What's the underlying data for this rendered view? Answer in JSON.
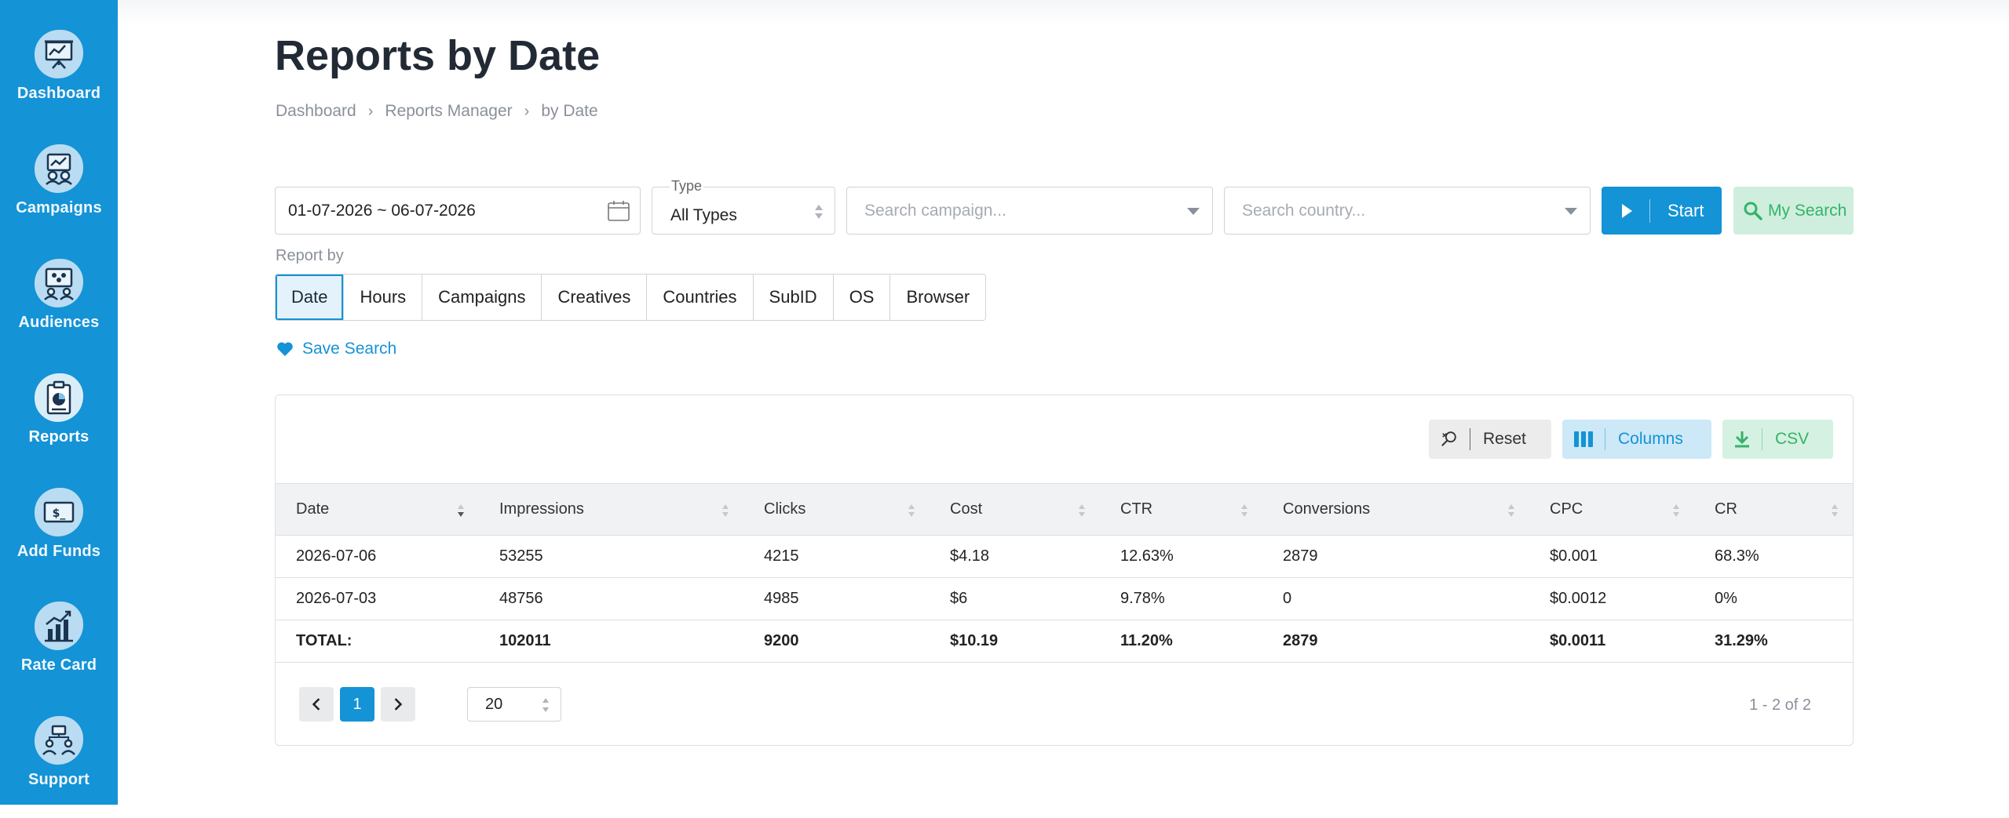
{
  "sidebar": {
    "items": [
      {
        "label": "Dashboard",
        "icon": "dashboard-icon"
      },
      {
        "label": "Campaigns",
        "icon": "campaigns-icon"
      },
      {
        "label": "Audiences",
        "icon": "audiences-icon"
      },
      {
        "label": "Reports",
        "icon": "reports-icon",
        "active": true
      },
      {
        "label": "Add Funds",
        "icon": "add-funds-icon"
      },
      {
        "label": "Rate Card",
        "icon": "rate-card-icon"
      },
      {
        "label": "Support",
        "icon": "support-icon"
      }
    ]
  },
  "page": {
    "title": "Reports by Date",
    "breadcrumb": [
      "Dashboard",
      "Reports Manager",
      "by Date"
    ]
  },
  "filters": {
    "date_range": "01-07-2026 ~ 06-07-2026",
    "type_label": "Type",
    "type_value": "All Types",
    "campaign_placeholder": "Search campaign...",
    "country_placeholder": "Search country...",
    "start_label": "Start",
    "my_search_label": "My Search",
    "report_by_label": "Report by",
    "report_by_options": [
      "Date",
      "Hours",
      "Campaigns",
      "Creatives",
      "Countries",
      "SubID",
      "OS",
      "Browser"
    ],
    "report_by_selected": "Date",
    "save_search_label": "Save Search"
  },
  "toolbar": {
    "reset_label": "Reset",
    "columns_label": "Columns",
    "csv_label": "CSV"
  },
  "table": {
    "columns": [
      "Date",
      "Impressions",
      "Clicks",
      "Cost",
      "CTR",
      "Conversions",
      "CPC",
      "CR"
    ],
    "rows": [
      [
        "2026-07-06",
        "53255",
        "4215",
        "$4.18",
        "12.63%",
        "2879",
        "$0.001",
        "68.3%"
      ],
      [
        "2026-07-03",
        "48756",
        "4985",
        "$6",
        "9.78%",
        "0",
        "$0.0012",
        "0%"
      ]
    ],
    "total": [
      "TOTAL:",
      "102011",
      "9200",
      "$10.19",
      "11.20%",
      "2879",
      "$0.0011",
      "31.29%"
    ]
  },
  "pagination": {
    "current_page": "1",
    "page_size": "20",
    "range_text": "1 - 2 of 2"
  },
  "colors": {
    "sidebar": "#1493d6",
    "accent": "#1493d6",
    "success": "#34b36a"
  }
}
